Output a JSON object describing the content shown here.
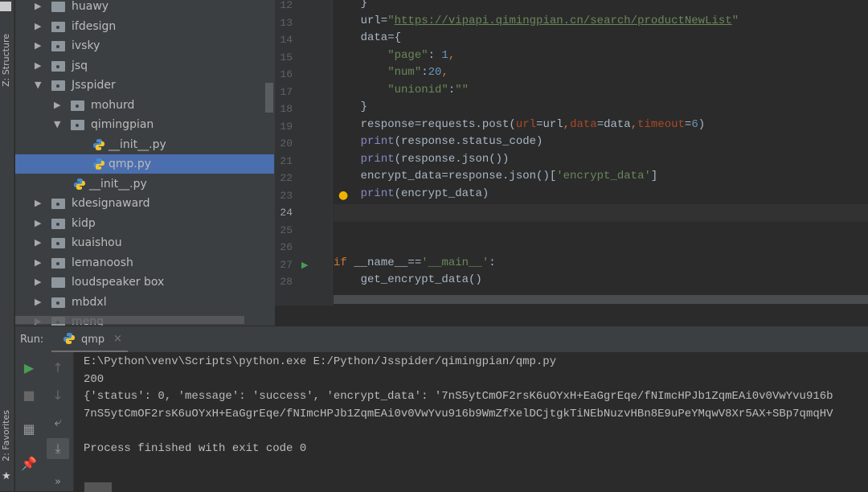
{
  "sidebar_strip": {
    "structure_label": "Z: Structure",
    "favorites_label": "2: Favorites"
  },
  "project_tree": [
    {
      "label": "huawy",
      "depth": 0,
      "type": "folder",
      "expanded": false
    },
    {
      "label": "ifdesign",
      "depth": 0,
      "type": "package",
      "expanded": false
    },
    {
      "label": "ivsky",
      "depth": 0,
      "type": "package",
      "expanded": false
    },
    {
      "label": "jsq",
      "depth": 0,
      "type": "package",
      "expanded": false
    },
    {
      "label": "Jsspider",
      "depth": 0,
      "type": "package",
      "expanded": true
    },
    {
      "label": "mohurd",
      "depth": 1,
      "type": "package",
      "expanded": false
    },
    {
      "label": "qimingpian",
      "depth": 1,
      "type": "package",
      "expanded": true
    },
    {
      "label": "__init__.py",
      "depth": 2,
      "type": "py"
    },
    {
      "label": "qmp.py",
      "depth": 2,
      "type": "py",
      "selected": true
    },
    {
      "label": "__init__.py",
      "depth": 1,
      "type": "py"
    },
    {
      "label": "kdesignaward",
      "depth": 0,
      "type": "package",
      "expanded": false
    },
    {
      "label": "kidp",
      "depth": 0,
      "type": "package",
      "expanded": false
    },
    {
      "label": "kuaishou",
      "depth": 0,
      "type": "package",
      "expanded": false
    },
    {
      "label": "lemanoosh",
      "depth": 0,
      "type": "package",
      "expanded": false
    },
    {
      "label": "loudspeaker box",
      "depth": 0,
      "type": "folder",
      "expanded": false
    },
    {
      "label": "mbdxl",
      "depth": 0,
      "type": "package",
      "expanded": false
    },
    {
      "label": "meng",
      "depth": 0,
      "type": "package",
      "expanded": false
    }
  ],
  "editor": {
    "current_line": 24,
    "lines": [
      {
        "n": 12,
        "tokens": [
          [
            "    }",
            ""
          ]
        ]
      },
      {
        "n": 13,
        "tokens": [
          [
            "    url=",
            ""
          ],
          [
            "\"",
            "str"
          ],
          [
            "https://vipapi.qimingpian.cn/search/productNewList",
            "url"
          ],
          [
            "\"",
            "str"
          ]
        ]
      },
      {
        "n": 14,
        "tokens": [
          [
            "    data={",
            ""
          ]
        ]
      },
      {
        "n": 15,
        "tokens": [
          [
            "        ",
            ""
          ],
          [
            "\"page\"",
            "str"
          ],
          [
            ": ",
            ""
          ],
          [
            "1",
            "num"
          ],
          [
            ",",
            "kw"
          ]
        ]
      },
      {
        "n": 16,
        "tokens": [
          [
            "        ",
            ""
          ],
          [
            "\"num\"",
            "str"
          ],
          [
            ":",
            ""
          ],
          [
            "20",
            "num"
          ],
          [
            ",",
            "kw"
          ]
        ]
      },
      {
        "n": 17,
        "tokens": [
          [
            "        ",
            ""
          ],
          [
            "\"unionid\"",
            "str"
          ],
          [
            ":",
            ""
          ],
          [
            "\"\"",
            "str"
          ]
        ]
      },
      {
        "n": 18,
        "tokens": [
          [
            "    }",
            ""
          ]
        ]
      },
      {
        "n": 19,
        "tokens": [
          [
            "    response=requests.post(",
            ""
          ],
          [
            "url",
            "param"
          ],
          [
            "=url",
            ""
          ],
          [
            ",",
            "kw"
          ],
          [
            "data",
            "param"
          ],
          [
            "=data",
            ""
          ],
          [
            ",",
            "kw"
          ],
          [
            "timeout",
            "param"
          ],
          [
            "=",
            ""
          ],
          [
            "6",
            "num"
          ],
          [
            ")",
            ""
          ]
        ]
      },
      {
        "n": 20,
        "tokens": [
          [
            "    ",
            ""
          ],
          [
            "print",
            "fn"
          ],
          [
            "(response.status_code)",
            ""
          ]
        ]
      },
      {
        "n": 21,
        "tokens": [
          [
            "    ",
            ""
          ],
          [
            "print",
            "fn"
          ],
          [
            "(response.json())",
            ""
          ]
        ]
      },
      {
        "n": 22,
        "tokens": [
          [
            "    encrypt_data=response.json()[",
            ""
          ],
          [
            "'encrypt_data'",
            "str"
          ],
          [
            "]",
            ""
          ]
        ]
      },
      {
        "n": 23,
        "tokens": [
          [
            "    ",
            ""
          ],
          [
            "print",
            "fn"
          ],
          [
            "(encrypt_data)",
            ""
          ]
        ]
      },
      {
        "n": 24,
        "tokens": []
      },
      {
        "n": 25,
        "tokens": []
      },
      {
        "n": 26,
        "tokens": []
      },
      {
        "n": 27,
        "tokens": [
          [
            "if",
            "kw"
          ],
          [
            " __name__==",
            ""
          ],
          [
            "'__main__'",
            "str"
          ],
          [
            ":",
            ""
          ]
        ]
      },
      {
        "n": 28,
        "tokens": [
          [
            "    get_encrypt_data()",
            ""
          ]
        ]
      }
    ]
  },
  "run": {
    "label": "Run:",
    "tab_name": "qmp",
    "close": "×",
    "output": [
      "E:\\Python\\venv\\Scripts\\python.exe E:/Python/Jsspider/qimingpian/qmp.py",
      "200",
      "{'status': 0, 'message': 'success', 'encrypt_data': '7nS5ytCmOF2rsK6uOYxH+EaGgrEqe/fNImcHPJb1ZqmEAi0v0VwYvu916b",
      "7nS5ytCmOF2rsK6uOYxH+EaGgrEqe/fNImcHPJb1ZqmEAi0v0VwYvu916b9WmZfXelDCjtgkTiNEbNuzvHBn8E9uPeYMqwV8Xr5AX+SBp7qmqHV",
      "",
      "Process finished with exit code 0"
    ],
    "more": "»"
  },
  "colors": {
    "accent": "#4b6eaf",
    "run_green": "#499c54",
    "bulb": "#f0b400"
  }
}
